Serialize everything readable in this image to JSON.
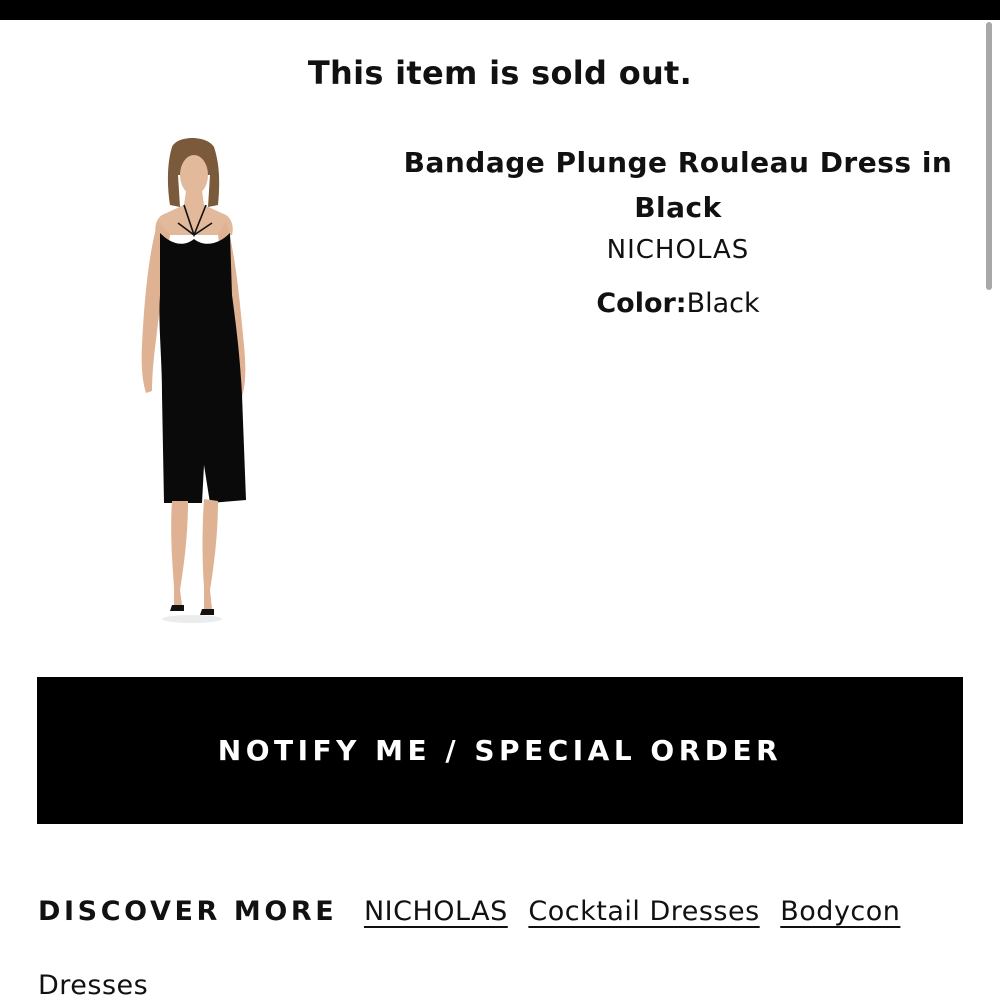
{
  "page": {
    "sold_out_message": "This item is sold out."
  },
  "product": {
    "title": "Bandage Plunge Rouleau Dress in Black",
    "brand": "NICHOLAS",
    "color_label": "Color:",
    "color_value": "Black"
  },
  "actions": {
    "notify_label": "NOTIFY ME / SPECIAL ORDER"
  },
  "discover": {
    "heading": "DISCOVER MORE",
    "links": [
      "NICHOLAS",
      "Cocktail Dresses",
      "Bodycon Dresses"
    ]
  },
  "colors": {
    "top_bar": "#000000",
    "button_bg": "#000000",
    "button_text": "#ffffff",
    "scrollbar": "#a8a8a8"
  }
}
